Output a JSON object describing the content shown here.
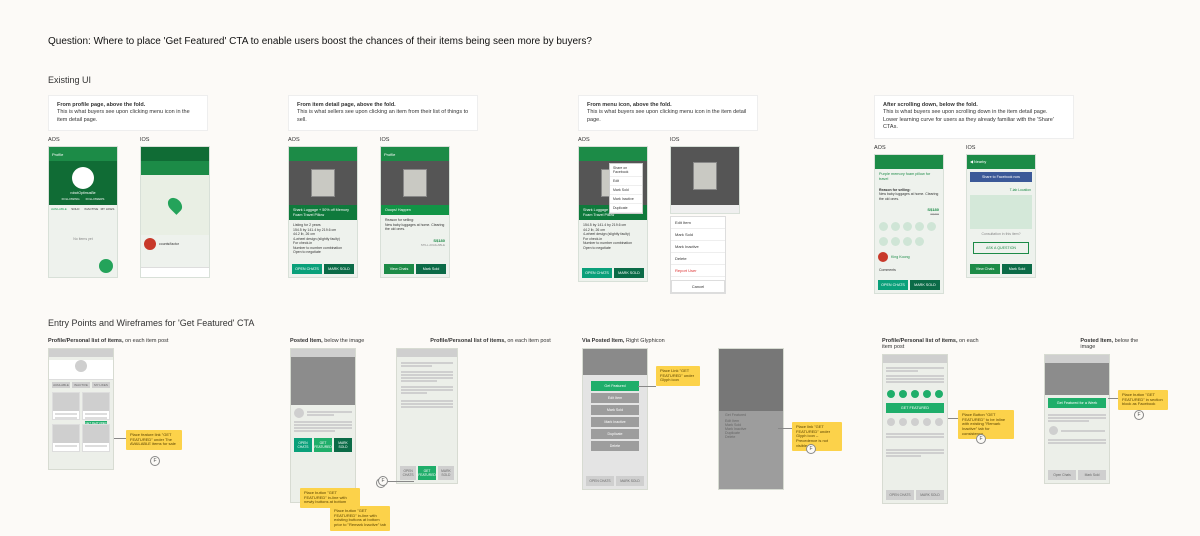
{
  "question": "Question: Where to place 'Get Featured' CTA to enable users boost the chances of their items being seen more by buyers?",
  "section1_title": "Existing UI",
  "section2_title": "Entry Points and Wireframes for 'Get Featured' CTA",
  "platforms": {
    "aos": "AOS",
    "ios": "iOS"
  },
  "notes": {
    "n1_b": "From profile page, above the fold.",
    "n1_t": "This is what buyers see upon clicking menu icon in the item detail page.",
    "n2_b": "From item detail page, above the fold.",
    "n2_t": "This is what sellers see upon clicking an item from their list of things to sell.",
    "n3_b": "From menu icon, above the fold.",
    "n3_t": "This is what buyers see upon clicking menu icon in the item detail page.",
    "n4_b": "After scrolling down, below the fold.",
    "n4_t1": "This is what buyers see upon scrolling down in the item detail page.",
    "n4_t2": "Lower learning curve for users as they already familiar with the 'Share' CTAs."
  },
  "mock": {
    "profile_header": "Profile",
    "item_title": "Shark Luggage + 50% off Memory Foam Travel Pillow",
    "item_desc1": "Listing for 2 years",
    "item_desc2": "Listed 2 days ago",
    "item_spec": "154.5 by 141.4 by 219.6 cm\n44.2 lb, 26 cm\n4-wheel design (slightly faulty)\nFor check-in\nNumber to number combination\nOpen to negotiate",
    "oops": "Ooops! Happen",
    "reason_title": "Reason for selling:",
    "reason_txt": "New baby luggages at home. Clearing the old ones.",
    "price": "S$180",
    "price_strike": "S$200",
    "open_chats": "OPEN CHATS",
    "mark_sold": "MARK SOLD",
    "view_chats": "View Chats",
    "mark_sold2": "Mark Sold",
    "edit": "Edit",
    "share_fb": "Share on Facebook",
    "mark_inactive": "Mark Inactive",
    "duplicate": "Duplicate",
    "edit_item": "Edit Item",
    "mark_sold_m": "Mark Sold",
    "mark_inactive_m": "Mark Inactive",
    "delete": "Delete",
    "report_user": "Report User",
    "cancel": "Cancel",
    "item2_title": "Purple memory foam pillow for travel",
    "share_fb_now": "Share to Facebook now",
    "tag_location": "T-lab Location",
    "ask_q": "ASK A QUESTION",
    "comments": "Comments",
    "nearby": "Nearby",
    "king_koong": "King Koong",
    "tab_sold": "SOLD",
    "tab_inactive": "INACTIVE",
    "tab_mylikes": "MY LIKES",
    "tab_following": "FOLLOWING",
    "tab_followers": "FOLLOWERS",
    "consultation": "Consultation in this item?",
    "still_avail": "STILL AVAILABLE"
  },
  "wf_caps": {
    "c1_b": "Profile/Personal list of items,",
    "c1_t": " on each item post",
    "c2_b": "Posted Item,",
    "c2_t": " below the image",
    "c3_b": "Profile/Personal list of items,",
    "c3_t": " on each item post",
    "c4_b": "Via Posted Item,",
    "c4_t": " Right Glyphicon",
    "c5_b": "Profile/Personal list of items,",
    "c5_t": " on each item post",
    "c6_b": "Posted Item,",
    "c6_t": " below the image"
  },
  "wf": {
    "available": "AVAILABLE",
    "inactive": "INACTIVE",
    "my_likes": "MY LIKES",
    "open_chats": "OPEN CHATS",
    "get_featured": "GET FEATURED",
    "mark_sold": "MARK SOLD",
    "get_featured2": "Get Featured",
    "edit_item": "Edit Item",
    "mark_sold2": "Mark Sold",
    "mark_inactive": "Mark Inactive",
    "duplicate": "Duplicate",
    "delete": "Delete",
    "gff_week": "Get Featured for a Week",
    "open_chats2": "Open Chats",
    "mark_sold3": "Mark Sold"
  },
  "anno": {
    "a1": "Place feature link \"GET FEATURED\" under The AVAILABLE items for sale",
    "a2": "Place button \"GET FEATURED\" in-line with newly buttons at bottom",
    "a3": "Place button \"GET FEATURED\" in-line with existing buttons at bottom prior to \"Remark Inactive\" tab",
    "a4": "Place Link \"GET FEATURED\" under Glyph icon",
    "a5": "Place link \"GET FEATURED\" under Glyph icon – Precedence is not visible",
    "a6": "Place Button \"GET FEATURED\" to be inline with existing \"Remark Inactive\" tab for consistency",
    "a7": "Place button \"GET FEATURED\" in section block as Facebook"
  },
  "f_label": "F"
}
